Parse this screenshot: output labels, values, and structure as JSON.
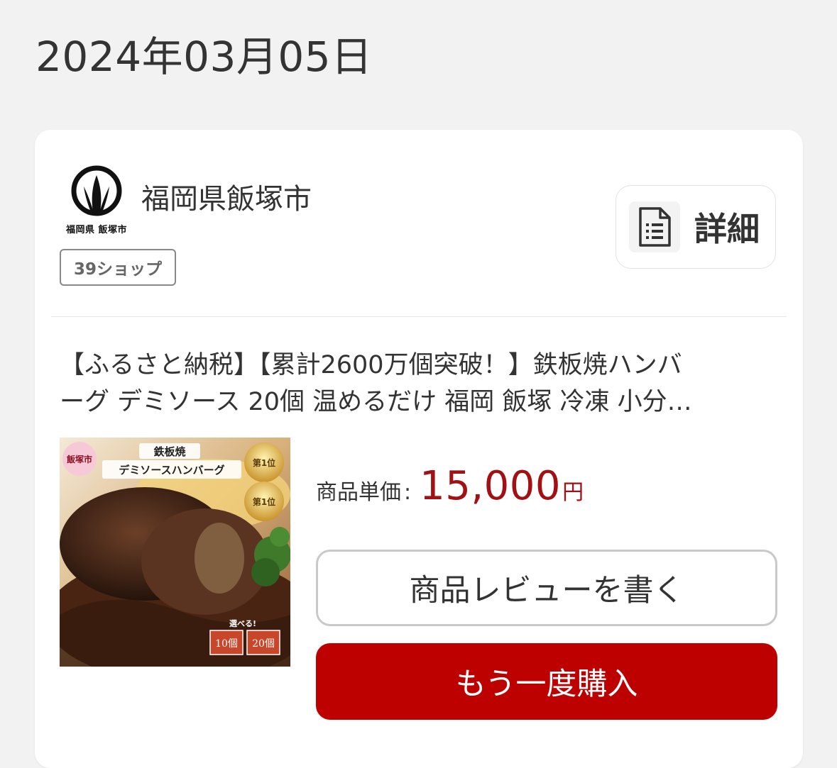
{
  "order_date": "2024年03月05日",
  "shop": {
    "logo_caption": "福岡県 飯塚市",
    "name": "福岡県飯塚市",
    "badge": "39ショップ"
  },
  "detail_button": {
    "label": "詳細",
    "icon": "document-icon"
  },
  "product": {
    "title_line1": "【ふるさと納税】【累計2600万個突破！】鉄板焼ハンバ",
    "title_line2": "ーグ デミソース 20個 温めるだけ 福岡 飯塚 冷凍 小分…",
    "image": {
      "badge": "飯塚市",
      "heading_top": "鉄板焼",
      "heading_main": "デミソースハンバーグ",
      "award_text": "第1位",
      "choose_label": "選べる!",
      "option_10": "10個",
      "option_20": "20個"
    },
    "price_label": "商品単価",
    "price_colon": ":",
    "price_value": "15,000",
    "price_unit": "円"
  },
  "review_button": {
    "label": "商品レビューを書く"
  },
  "buy_button": {
    "label": "もう一度購入"
  },
  "colors": {
    "accent_red": "#bd0000",
    "price_red": "#a30f12",
    "background": "#f2f2f2",
    "card": "#ffffff"
  }
}
